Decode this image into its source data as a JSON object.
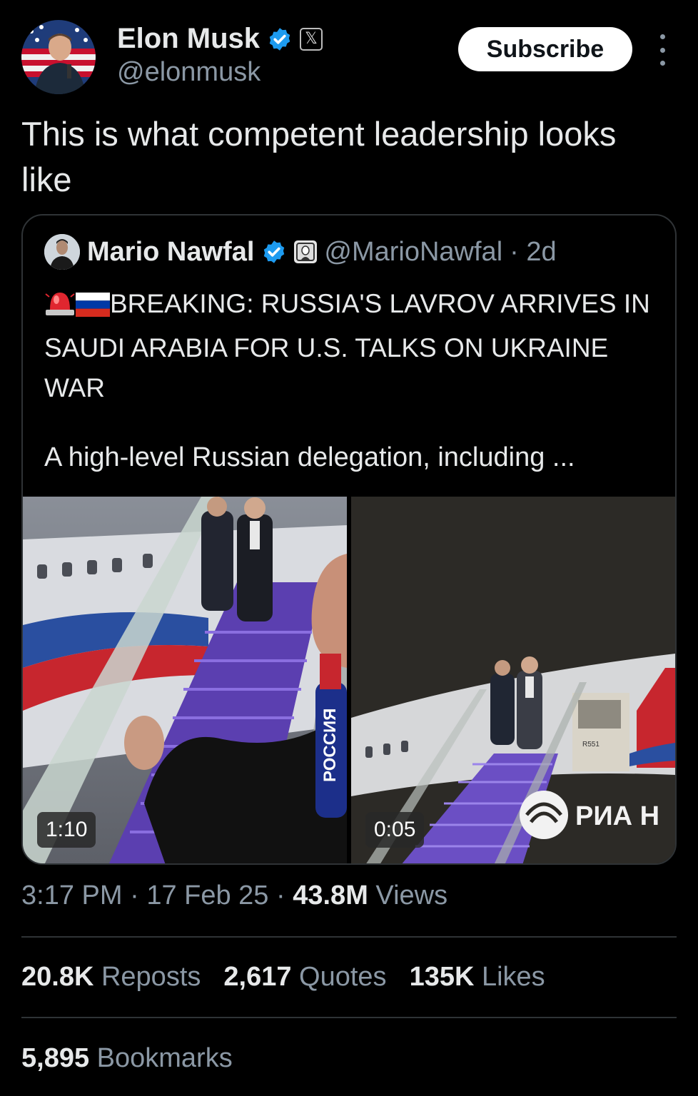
{
  "author": {
    "display_name": "Elon Musk",
    "handle": "@elonmusk",
    "x_badge": "𝕏"
  },
  "subscribe_label": "Subscribe",
  "tweet_text": "This is what competent leadership looks like",
  "quoted": {
    "display_name": "Mario Nawfal",
    "handle": "@MarioNawfal",
    "time": "· 2d",
    "headline": "BREAKING: RUSSIA'S LAVROV ARRIVES IN SAUDI ARABIA FOR U.S. TALKS ON UKRAINE WAR",
    "body_preview": "A high-level Russian delegation, including ...",
    "media": [
      {
        "duration": "1:10",
        "mic_text": "РОССИЯ"
      },
      {
        "duration": "0:05",
        "watermark": "РИА Н",
        "plane_reg": "R551"
      }
    ]
  },
  "meta": {
    "time": "3:17 PM",
    "date": "17 Feb 25",
    "views_count": "43.8M",
    "views_label": "Views"
  },
  "stats": {
    "reposts_count": "20.8K",
    "reposts_label": "Reposts",
    "quotes_count": "2,617",
    "quotes_label": "Quotes",
    "likes_count": "135K",
    "likes_label": "Likes",
    "bookmarks_count": "5,895",
    "bookmarks_label": "Bookmarks"
  },
  "colors": {
    "background": "#000000",
    "text_primary": "#e7e9ea",
    "text_secondary": "#8b98a5",
    "verified_blue": "#1d9bf0",
    "divider": "#2f3336",
    "stairs_purple": "#6b4fc4"
  },
  "icons": [
    "verified-badge-icon",
    "x-affiliate-icon",
    "more-vertical-icon",
    "siren-emoji",
    "russia-flag-emoji"
  ]
}
